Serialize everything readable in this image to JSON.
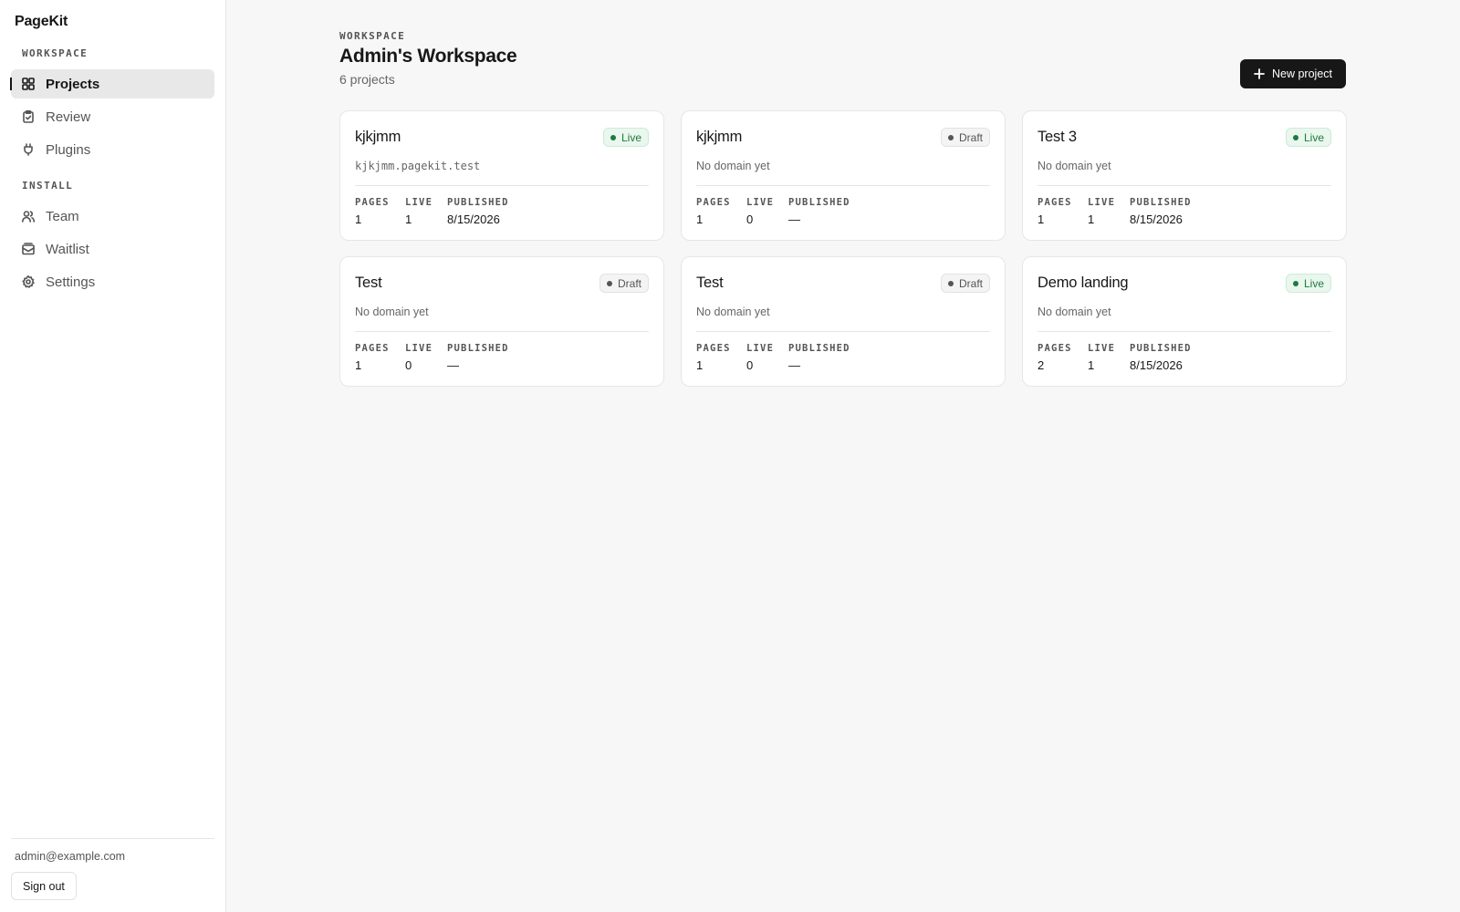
{
  "app": {
    "brand": "PageKit"
  },
  "sidebar": {
    "sections": [
      {
        "label": "WORKSPACE",
        "items": [
          {
            "label": "Projects",
            "icon": "grid-icon",
            "active": true
          },
          {
            "label": "Review",
            "icon": "clipboard-check-icon",
            "active": false
          },
          {
            "label": "Plugins",
            "icon": "plug-icon",
            "active": false
          }
        ]
      },
      {
        "label": "INSTALL",
        "items": [
          {
            "label": "Team",
            "icon": "users-icon",
            "active": false
          },
          {
            "label": "Waitlist",
            "icon": "inbox-mail-icon",
            "active": false
          },
          {
            "label": "Settings",
            "icon": "gear-icon",
            "active": false
          }
        ]
      }
    ],
    "user_email": "admin@example.com",
    "sign_out_label": "Sign out"
  },
  "header": {
    "eyebrow": "WORKSPACE",
    "title": "Admin's Workspace",
    "subtitle": "6 projects",
    "new_project_label": "New project"
  },
  "stat_labels": {
    "pages": "PAGES",
    "live": "LIVE",
    "published": "PUBLISHED"
  },
  "projects": [
    {
      "name": "kjkjmm",
      "status": "Live",
      "domain": "kjkjmm.pagekit.test",
      "domain_is_mono": true,
      "pages": "1",
      "live": "1",
      "published": "8/15/2026"
    },
    {
      "name": "kjkjmm",
      "status": "Draft",
      "domain": "No domain yet",
      "domain_is_mono": false,
      "pages": "1",
      "live": "0",
      "published": "—"
    },
    {
      "name": "Test 3",
      "status": "Live",
      "domain": "No domain yet",
      "domain_is_mono": false,
      "pages": "1",
      "live": "1",
      "published": "8/15/2026"
    },
    {
      "name": "Test",
      "status": "Draft",
      "domain": "No domain yet",
      "domain_is_mono": false,
      "pages": "1",
      "live": "0",
      "published": "—"
    },
    {
      "name": "Test",
      "status": "Draft",
      "domain": "No domain yet",
      "domain_is_mono": false,
      "pages": "1",
      "live": "0",
      "published": "—"
    },
    {
      "name": "Demo landing",
      "status": "Live",
      "domain": "No domain yet",
      "domain_is_mono": false,
      "pages": "2",
      "live": "1",
      "published": "8/15/2026"
    }
  ],
  "colors": {
    "accent": "#171717",
    "live": "#1f7a3f",
    "live_bg": "#e9f7ee",
    "draft": "#555555"
  }
}
